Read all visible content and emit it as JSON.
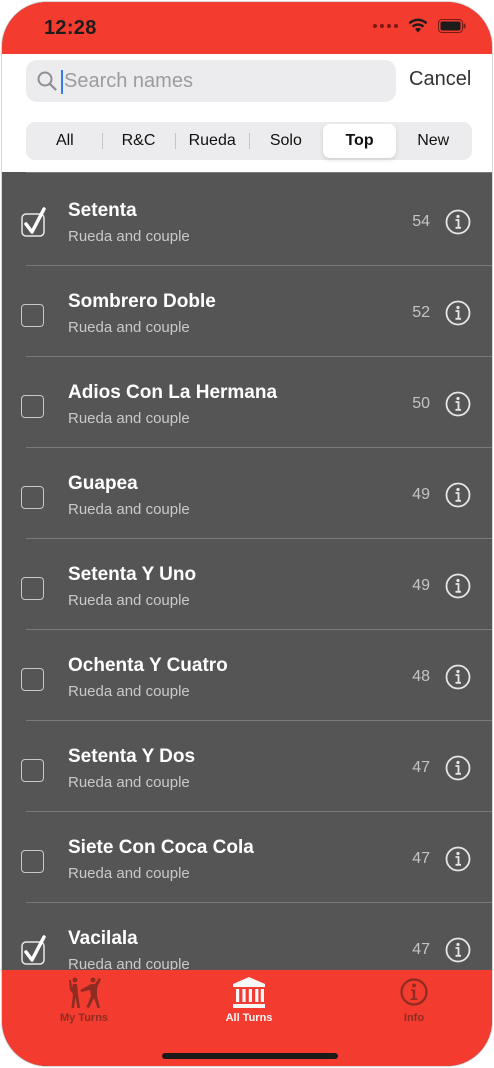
{
  "status_bar": {
    "time": "12:28"
  },
  "search": {
    "placeholder": "Search names",
    "value": "",
    "cancel_label": "Cancel"
  },
  "filter": {
    "segments": [
      "All",
      "R&C",
      "Rueda",
      "Solo",
      "Top",
      "New"
    ],
    "selected": "Top"
  },
  "list": {
    "items": [
      {
        "title": "Setenta",
        "subtitle": "Rueda and couple",
        "count": "54",
        "checked": true
      },
      {
        "title": "Sombrero Doble",
        "subtitle": "Rueda and couple",
        "count": "52",
        "checked": false
      },
      {
        "title": "Adios Con La Hermana",
        "subtitle": "Rueda and couple",
        "count": "50",
        "checked": false
      },
      {
        "title": "Guapea",
        "subtitle": "Rueda and couple",
        "count": "49",
        "checked": false
      },
      {
        "title": "Setenta Y Uno",
        "subtitle": "Rueda and couple",
        "count": "49",
        "checked": false
      },
      {
        "title": "Ochenta Y Cuatro",
        "subtitle": "Rueda and couple",
        "count": "48",
        "checked": false
      },
      {
        "title": "Setenta Y Dos",
        "subtitle": "Rueda and couple",
        "count": "47",
        "checked": false
      },
      {
        "title": "Siete Con Coca Cola",
        "subtitle": "Rueda and couple",
        "count": "47",
        "checked": false
      },
      {
        "title": "Vacilala",
        "subtitle": "Rueda and couple",
        "count": "47",
        "checked": true
      }
    ]
  },
  "tab_bar": {
    "tabs": [
      {
        "label": "My Turns",
        "icon": "dancers-icon",
        "active": false
      },
      {
        "label": "All Turns",
        "icon": "building-columns-icon",
        "active": true
      },
      {
        "label": "Info",
        "icon": "info-circle-icon",
        "active": false
      }
    ]
  },
  "colors": {
    "accent": "#f33b2f",
    "list_background": "#555555",
    "active_tab": "#f7f7f7",
    "inactive_tab": "#8e2c23"
  }
}
